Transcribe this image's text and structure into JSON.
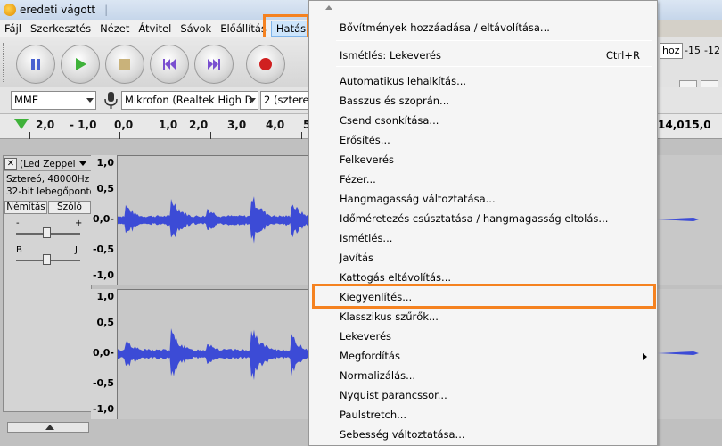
{
  "window": {
    "title": "eredeti vágott",
    "title_sep": "|"
  },
  "menubar": {
    "items": [
      "Fájl",
      "Szerkesztés",
      "Nézet",
      "Átvitel",
      "Sávok",
      "Előállítás",
      "Hatás"
    ],
    "active": "Hatás"
  },
  "device": {
    "host": "MME",
    "input": "Mikrofon (Realtek High D",
    "channels": "2 (sztereó"
  },
  "ruler": {
    "labels": [
      "2,0",
      "- 1,0",
      "0,0",
      "1,0",
      "2,0",
      "3,0",
      "4,0",
      "5"
    ]
  },
  "track": {
    "name": "(Led Zeppel",
    "info1": "Sztereó, 48000Hz",
    "info2": "32-bit lebegőpontos",
    "mute": "Némítás",
    "solo": "Szóló",
    "gain_minus": "-",
    "gain_plus": "+",
    "pan_left": "B",
    "pan_right": "J"
  },
  "vscale": [
    "1,0",
    "0,5",
    "0,0-",
    "-0,5",
    "-1,0"
  ],
  "right_strip": {
    "meter_text": "hoz",
    "meter_values": [
      "-15",
      "-12"
    ],
    "ruler_labels": [
      "14,0",
      "15,0"
    ]
  },
  "effects_menu": {
    "items": [
      {
        "label": "Bővítmények hozzáadása / eltávolítása..."
      },
      {
        "label": "Ismétlés: Lekeverés",
        "shortcut": "Ctrl+R"
      },
      {
        "label": "Automatikus lehalkítás..."
      },
      {
        "label": "Basszus és szoprán..."
      },
      {
        "label": "Csend csonkítása..."
      },
      {
        "label": "Erősítés..."
      },
      {
        "label": "Felkeverés"
      },
      {
        "label": "Fézer..."
      },
      {
        "label": "Hangmagasság változtatása..."
      },
      {
        "label": "Időméretezés csúsztatása / hangmagasság eltolás..."
      },
      {
        "label": "Ismétlés..."
      },
      {
        "label": "Javítás"
      },
      {
        "label": "Kattogás eltávolítás..."
      },
      {
        "label": "Kiegyenlítés..."
      },
      {
        "label": "Klasszikus szűrők..."
      },
      {
        "label": "Lekeverés"
      },
      {
        "label": "Megfordítás"
      },
      {
        "label": "Normalizálás..."
      },
      {
        "label": "Nyquist parancssor..."
      },
      {
        "label": "Paulstretch..."
      },
      {
        "label": "Sebesség változtatása..."
      }
    ],
    "highlighted": "Kiegyenlítés..."
  },
  "colors": {
    "highlight": "#f58220",
    "waveform": "#3c4bd6",
    "play": "#3fb23a",
    "record": "#d02020",
    "transport_blue": "#4a62d0"
  }
}
